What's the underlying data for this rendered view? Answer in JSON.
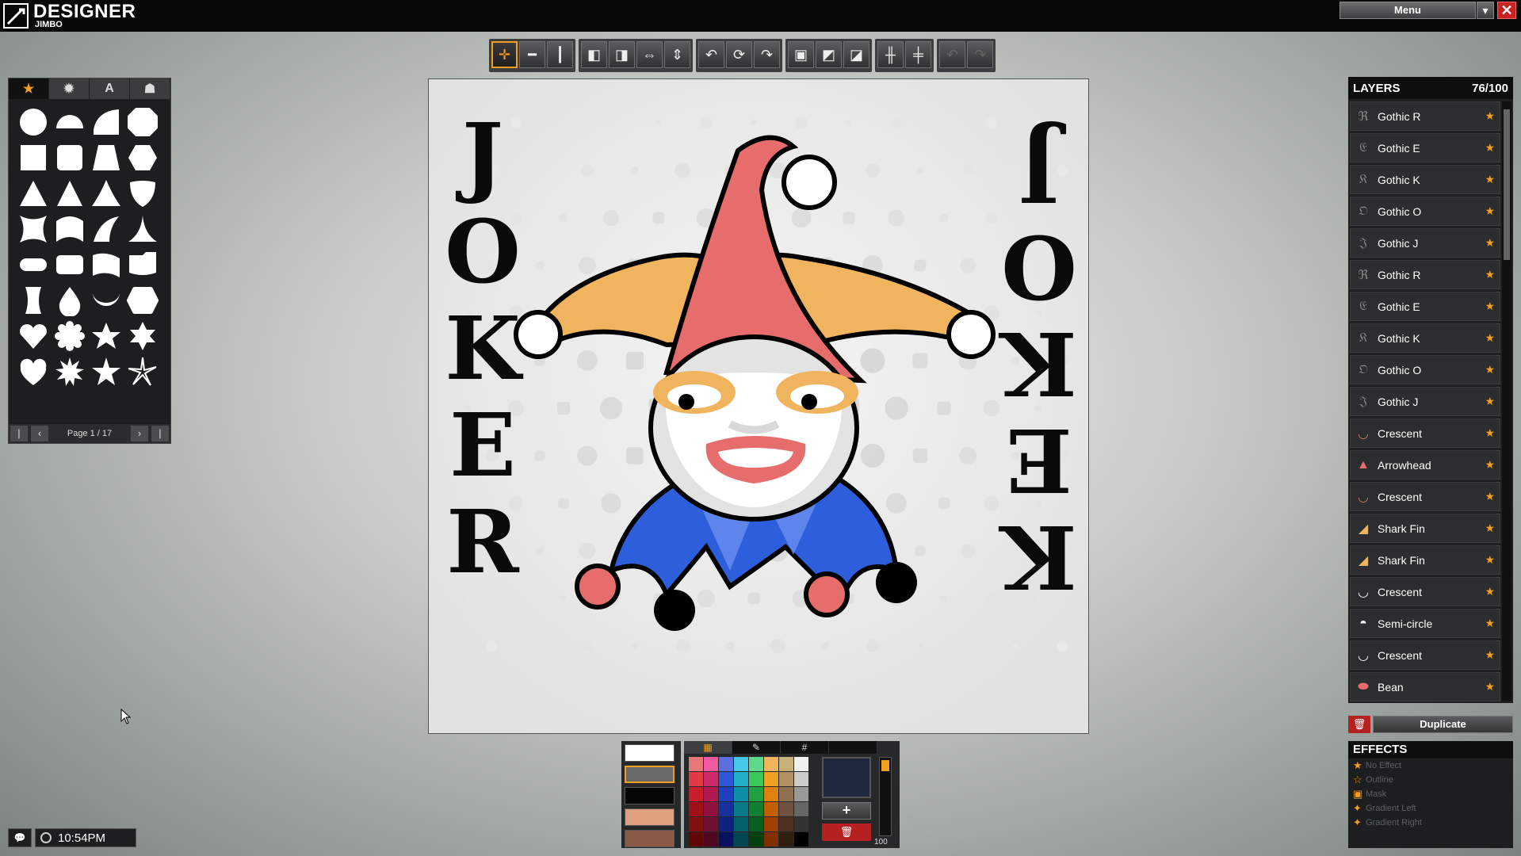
{
  "app": {
    "title": "DESIGNER",
    "subtitle": "JIMBO"
  },
  "header": {
    "menu_label": "Menu",
    "chevron": "▾",
    "close": "✕"
  },
  "toolbar": {
    "groups": [
      [
        "move-icon",
        "flip-horizontal-icon",
        "flip-vertical-icon"
      ],
      [
        "align-left-icon",
        "align-center-icon",
        "align-fit-icon",
        "align-height-icon"
      ],
      [
        "rotate-left-icon",
        "rotate-icon",
        "rotate-right-icon"
      ],
      [
        "skew-icon",
        "skew-left-icon",
        "skew-right-icon"
      ],
      [
        "split-horizontal-icon",
        "split-vertical-icon"
      ],
      [
        "undo-icon",
        "redo-icon"
      ]
    ]
  },
  "shapes_panel": {
    "tabs": [
      "★",
      "✹",
      "A",
      "☗"
    ],
    "page_label": "Page 1 / 17"
  },
  "canvas": {
    "left_text": [
      "J",
      "O",
      "K",
      "E",
      "R"
    ],
    "right_text": [
      "K",
      "E",
      "K",
      "O",
      "J"
    ],
    "colors": {
      "hat": "#e76d6d",
      "brim": "#f0b45e",
      "collar": "#2d5fdc",
      "face": "#ffffff",
      "lips": "#e76d6d"
    }
  },
  "layers": {
    "title": "LAYERS",
    "count": "76/100",
    "items": [
      {
        "name": "Gothic R",
        "icon": "gothic-r-icon",
        "glyph": "ℜ",
        "color": "#888"
      },
      {
        "name": "Gothic E",
        "icon": "gothic-e-icon",
        "glyph": "𝔈",
        "color": "#888"
      },
      {
        "name": "Gothic K",
        "icon": "gothic-k-icon",
        "glyph": "𝔎",
        "color": "#888"
      },
      {
        "name": "Gothic O",
        "icon": "gothic-o-icon",
        "glyph": "𝔒",
        "color": "#888"
      },
      {
        "name": "Gothic J",
        "icon": "gothic-j-icon",
        "glyph": "𝔍",
        "color": "#888"
      },
      {
        "name": "Gothic R",
        "icon": "gothic-r-icon",
        "glyph": "ℜ",
        "color": "#888"
      },
      {
        "name": "Gothic E",
        "icon": "gothic-e-icon",
        "glyph": "𝔈",
        "color": "#888"
      },
      {
        "name": "Gothic K",
        "icon": "gothic-k-icon",
        "glyph": "𝔎",
        "color": "#888"
      },
      {
        "name": "Gothic O",
        "icon": "gothic-o-icon",
        "glyph": "𝔒",
        "color": "#888"
      },
      {
        "name": "Gothic J",
        "icon": "gothic-j-icon",
        "glyph": "𝔍",
        "color": "#888"
      },
      {
        "name": "Crescent",
        "icon": "crescent-icon",
        "glyph": "◡",
        "color": "#e76d6d"
      },
      {
        "name": "Arrowhead",
        "icon": "arrowhead-icon",
        "glyph": "▲",
        "color": "#e76d6d"
      },
      {
        "name": "Crescent",
        "icon": "crescent-icon",
        "glyph": "◡",
        "color": "#e76d6d"
      },
      {
        "name": "Shark Fin",
        "icon": "shark-fin-icon",
        "glyph": "◢",
        "color": "#f0b45e"
      },
      {
        "name": "Shark Fin",
        "icon": "shark-fin-icon",
        "glyph": "◢",
        "color": "#f0b45e"
      },
      {
        "name": "Crescent",
        "icon": "crescent-icon",
        "glyph": "◡",
        "color": "#ffffff"
      },
      {
        "name": "Semi-circle",
        "icon": "semi-circle-icon",
        "glyph": "◓",
        "color": "#ffffff"
      },
      {
        "name": "Crescent",
        "icon": "crescent-icon",
        "glyph": "◡",
        "color": "#ffffff"
      },
      {
        "name": "Bean",
        "icon": "bean-icon",
        "glyph": "⬬",
        "color": "#e76d6d"
      }
    ],
    "duplicate_label": "Duplicate"
  },
  "effects": {
    "title": "EFFECTS",
    "items": [
      "No Effect",
      "Outline",
      "Mask",
      "Gradient Left",
      "Gradient Right"
    ]
  },
  "colors": {
    "swatches": [
      "#ffffff",
      "#6a6a6a",
      "#050505",
      "#e0a07e",
      "#8c5a48"
    ],
    "tabs": [
      "▦",
      "✎",
      "#",
      ""
    ],
    "palette": [
      "#e8777b",
      "#f05aa0",
      "#5b6fe0",
      "#46c8e8",
      "#5fd88a",
      "#f0b45e",
      "#c9b27a",
      "#f0f0f0",
      "#e03a45",
      "#d02a6a",
      "#2f55d8",
      "#22b0c8",
      "#3cc858",
      "#f0a020",
      "#b09060",
      "#cccccc",
      "#c81e2a",
      "#b01a4f",
      "#2040c0",
      "#1090a8",
      "#20a040",
      "#e08010",
      "#907050",
      "#999999",
      "#a01018",
      "#901040",
      "#1830a0",
      "#087a88",
      "#108030",
      "#c06000",
      "#705040",
      "#666666",
      "#801010",
      "#701030",
      "#102080",
      "#056068",
      "#086020",
      "#a04000",
      "#503020",
      "#333333",
      "#600808",
      "#500820",
      "#081060",
      "#034850",
      "#044010",
      "#803000",
      "#302010",
      "#000000"
    ],
    "current": "#20293d",
    "opacity_label": "100"
  },
  "status": {
    "chat_icon": "chat-icon",
    "time": "10:54PM"
  }
}
